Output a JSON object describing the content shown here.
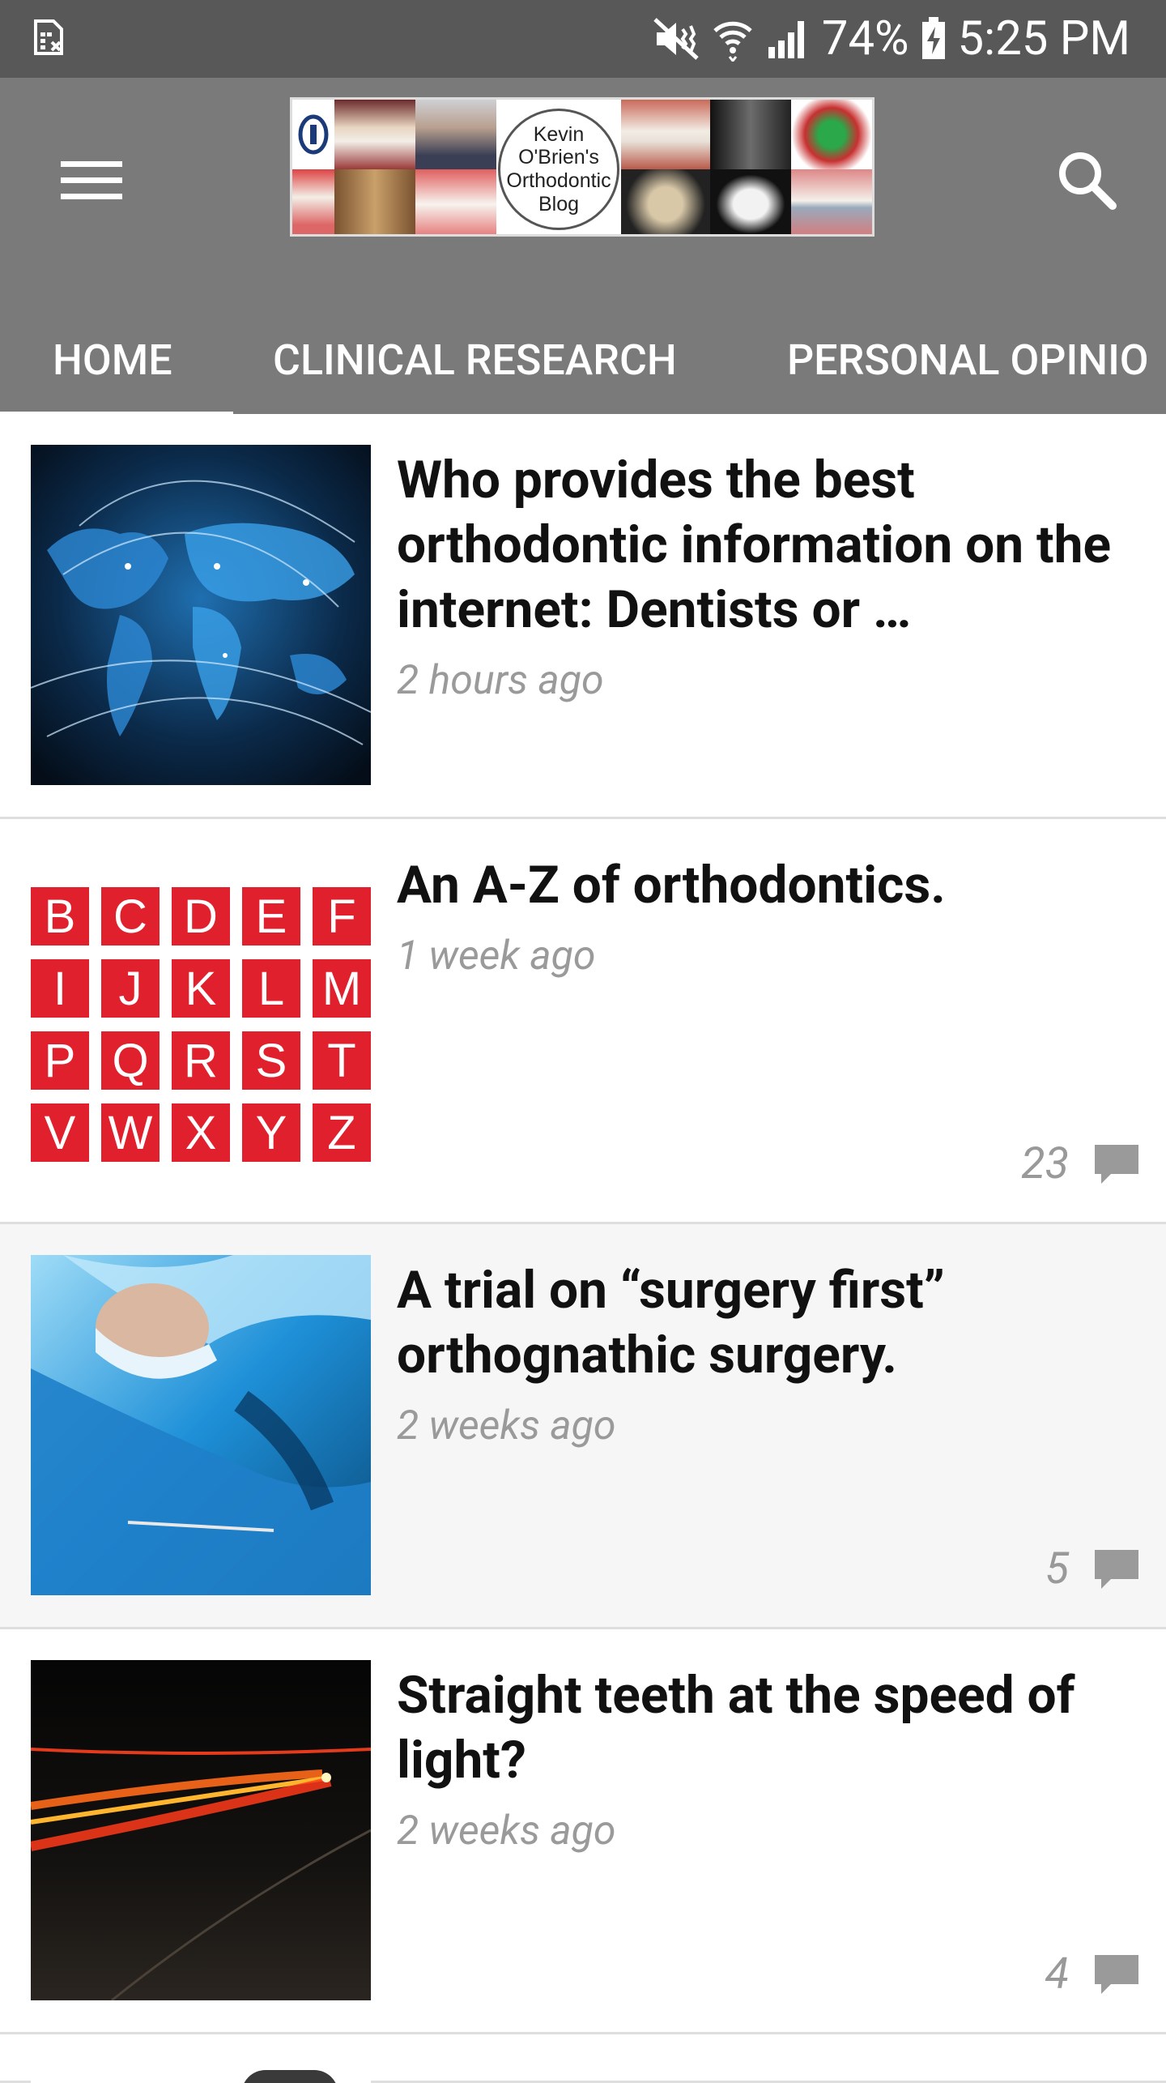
{
  "status_bar": {
    "battery": "74%",
    "time": "5:25 PM"
  },
  "app_bar": {
    "logo_text": [
      "Kevin",
      "O'Brien's",
      "Orthodontic",
      "Blog"
    ]
  },
  "tabs": [
    {
      "label": "HOME",
      "active": true
    },
    {
      "label": "CLINICAL RESEARCH",
      "active": false
    },
    {
      "label": "PERSONAL OPINIO",
      "active": false
    }
  ],
  "posts": [
    {
      "title": "Who provides the best orthodontic information on the internet: Dentists or …",
      "date": "2 hours ago",
      "comments": "",
      "thumb": "world-map-network"
    },
    {
      "title": "An A-Z of orthodontics.",
      "date": "1 week ago",
      "comments": "23",
      "thumb": "alphabet-tiles",
      "letters": [
        "B",
        "C",
        "D",
        "E",
        "F",
        "I",
        "J",
        "K",
        "L",
        "M",
        "P",
        "Q",
        "R",
        "S",
        "T",
        "V",
        "W",
        "X",
        "Y",
        "Z"
      ]
    },
    {
      "title": "A trial on “surgery first” orthognathic surgery.",
      "date": "2 weeks ago",
      "comments": "5",
      "thumb": "surgeon"
    },
    {
      "title": "Straight teeth at the speed of light?",
      "date": "2 weeks ago",
      "comments": "4",
      "thumb": "light-trails"
    }
  ],
  "colors": {
    "status_bar": "#585858",
    "app_bar": "#7a7a7a",
    "tile_red": "#e0202c"
  }
}
